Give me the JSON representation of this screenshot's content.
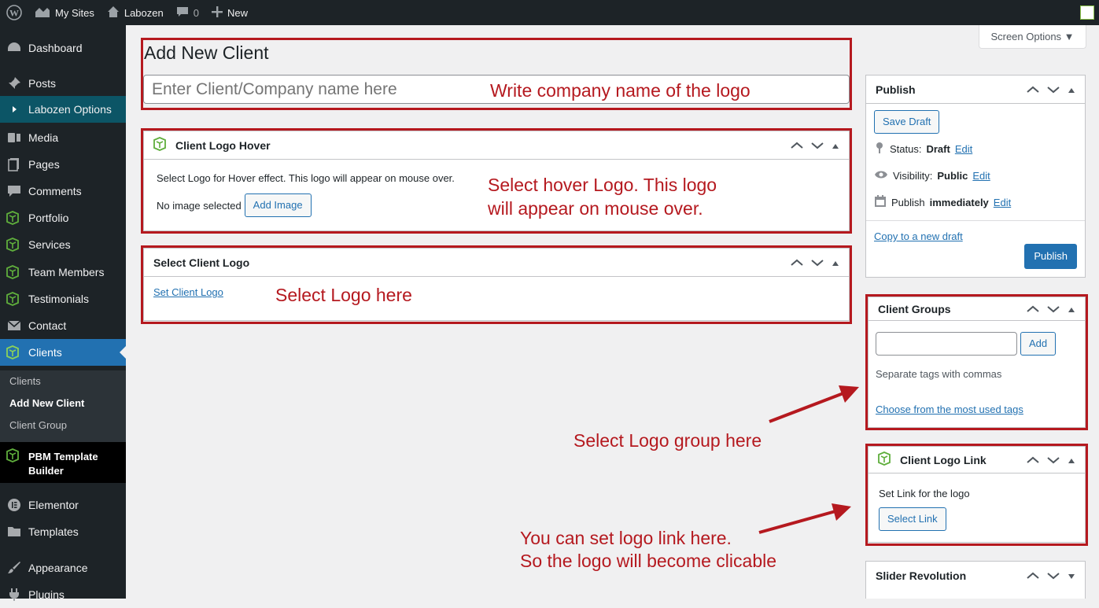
{
  "adminbar": {
    "my_sites": "My Sites",
    "site_name": "Labozen",
    "comments_count": "0",
    "new_label": "New"
  },
  "sidebar": {
    "items": {
      "dashboard": "Dashboard",
      "posts": "Posts",
      "labozen_options": "Labozen Options",
      "media": "Media",
      "pages": "Pages",
      "comments": "Comments",
      "portfolio": "Portfolio",
      "services": "Services",
      "team_members": "Team Members",
      "testimonials": "Testimonials",
      "contact": "Contact",
      "clients": "Clients",
      "pbm_template_builder": "PBM Template Builder",
      "elementor": "Elementor",
      "templates": "Templates",
      "appearance": "Appearance",
      "plugins": "Plugins"
    },
    "submenu": {
      "clients": "Clients",
      "add_new_client": "Add New Client",
      "client_group": "Client Group"
    }
  },
  "screen_options": "Screen Options ▼",
  "main": {
    "page_title": "Add New Client",
    "title_placeholder": "Enter Client/Company name here",
    "hover_box": {
      "title": "Client Logo Hover",
      "description": "Select Logo for Hover effect. This logo will appear on mouse over.",
      "no_image": "No image selected",
      "add_image": "Add Image"
    },
    "logo_box": {
      "title": "Select Client Logo",
      "set_link": "Set Client Logo"
    }
  },
  "publish": {
    "title": "Publish",
    "save_draft": "Save Draft",
    "status_label": "Status:",
    "status_value": "Draft",
    "edit": "Edit",
    "visibility_label": "Visibility:",
    "visibility_value": "Public",
    "publish_label": "Publish",
    "publish_value": "immediately",
    "copy_draft": "Copy to a new draft",
    "publish_button": "Publish"
  },
  "client_groups": {
    "title": "Client Groups",
    "add_button": "Add",
    "hint": "Separate tags with commas",
    "choose_link": "Choose from the most used tags"
  },
  "logo_link": {
    "title": "Client Logo Link",
    "label": "Set Link for the logo",
    "button": "Select Link"
  },
  "slider_revolution": {
    "title": "Slider Revolution"
  },
  "annotations": {
    "company_name": "Write company name of the logo",
    "hover_line1": "Select hover Logo. This logo",
    "hover_line2": "will appear on mouse over.",
    "select_logo": "Select Logo here",
    "logo_group": "Select Logo group here",
    "link_line1": "You can set logo link here.",
    "link_line2": "So the logo will become clicable"
  },
  "colors": {
    "annotation": "#b5191f",
    "admin_dark": "#1d2327",
    "primary": "#2271b1",
    "icon_green": "#5fae3c"
  }
}
